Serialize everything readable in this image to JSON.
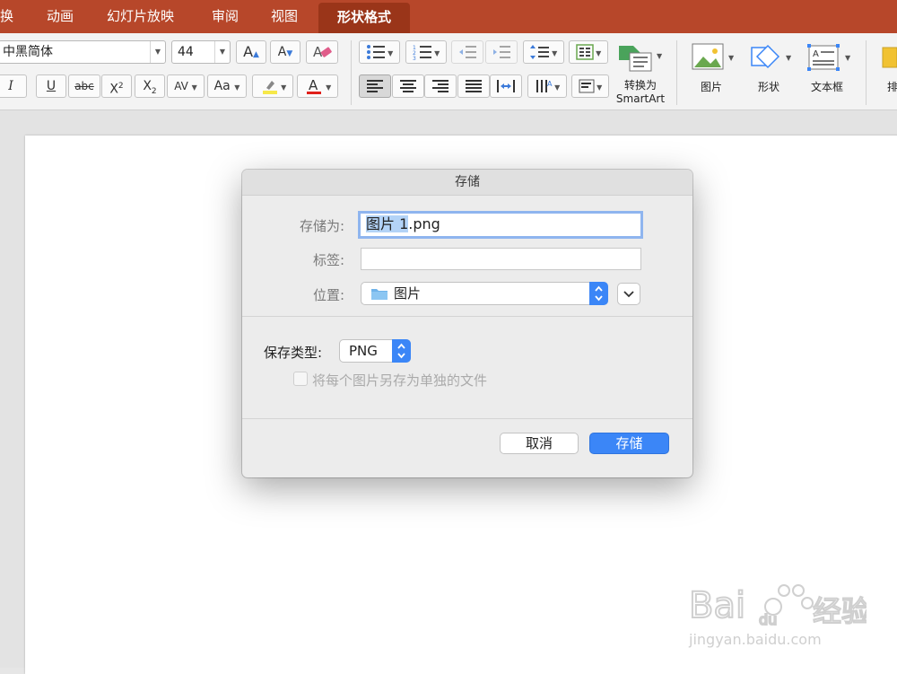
{
  "tabs": [
    {
      "label": "切换",
      "shown": "换"
    },
    {
      "label": "动画",
      "shown": "动画"
    },
    {
      "label": "幻灯片放映",
      "shown": "幻灯片放映"
    },
    {
      "label": "审阅",
      "shown": "审阅"
    },
    {
      "label": "视图",
      "shown": "视图"
    },
    {
      "label": "形状格式",
      "shown": "形状格式",
      "active": true
    }
  ],
  "ribbon": {
    "font_name": "中黑简体",
    "font_size": "44",
    "smartart_label_1": "转换为",
    "smartart_label_2": "SmartArt",
    "picture_label": "图片",
    "shape_label": "形状",
    "textbox_label": "文本框",
    "arrange_label": "排"
  },
  "dialog": {
    "title": "存储",
    "save_as_label": "存储为:",
    "filename_selected": "图片 1",
    "filename_rest": ".png",
    "tags_label": "标签:",
    "tags_value": "",
    "location_label": "位置:",
    "location_value": "图片",
    "format_label": "保存类型:",
    "format_value": "PNG",
    "checkbox_label": "将每个图片另存为单独的文件",
    "cancel_label": "取消",
    "save_label": "存储"
  },
  "colors": {
    "tab_bar": "#b7472a",
    "accent_blue": "#3b86f7",
    "focus_ring": "#8fb5ef"
  },
  "watermark": "Bai 经验 jingyan.baidu.com"
}
